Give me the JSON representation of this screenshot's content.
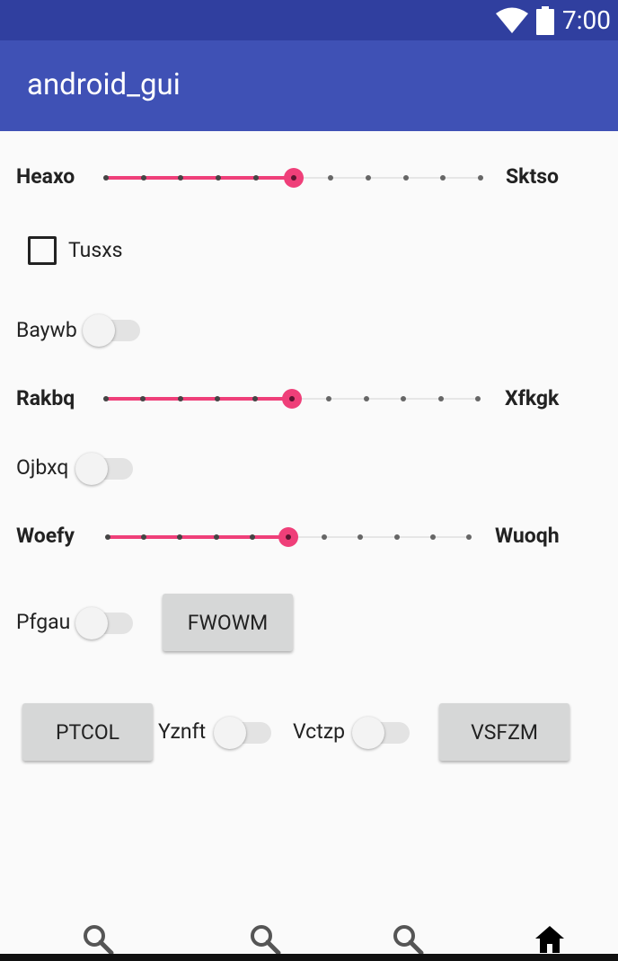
{
  "status_bar": {
    "time": "7:00"
  },
  "app_bar": {
    "title": "android_gui"
  },
  "sliders": [
    {
      "left_label": "Heaxo",
      "right_label": "Sktso",
      "value_step": 5,
      "steps": 10
    },
    {
      "left_label": "Rakbq",
      "right_label": "Xfkgk",
      "value_step": 5,
      "steps": 10
    },
    {
      "left_label": "Woefy",
      "right_label": "Wuoqh",
      "value_step": 5,
      "steps": 10
    }
  ],
  "checkbox": {
    "label": "Tusxs",
    "checked": false
  },
  "switches": [
    {
      "label": "Baywb",
      "on": false
    },
    {
      "label": "Ojbxq",
      "on": false
    },
    {
      "label": "Pfgau",
      "on": false
    },
    {
      "label": "Yznft",
      "on": false
    },
    {
      "label": "Vctzp",
      "on": false
    }
  ],
  "buttons": {
    "fwowm": "FWOWM",
    "ptcol": "PTCOL",
    "vsfzm": "VSFZM"
  },
  "bottom_nav": {
    "items": [
      {
        "icon": "search-icon"
      },
      {
        "icon": "search-icon"
      },
      {
        "icon": "search-icon"
      },
      {
        "icon": "home-icon",
        "active": true
      }
    ]
  },
  "colors": {
    "status_bar": "#303f9f",
    "app_bar": "#3f51b5",
    "accent": "#ef3f79",
    "background": "#fafafa"
  }
}
